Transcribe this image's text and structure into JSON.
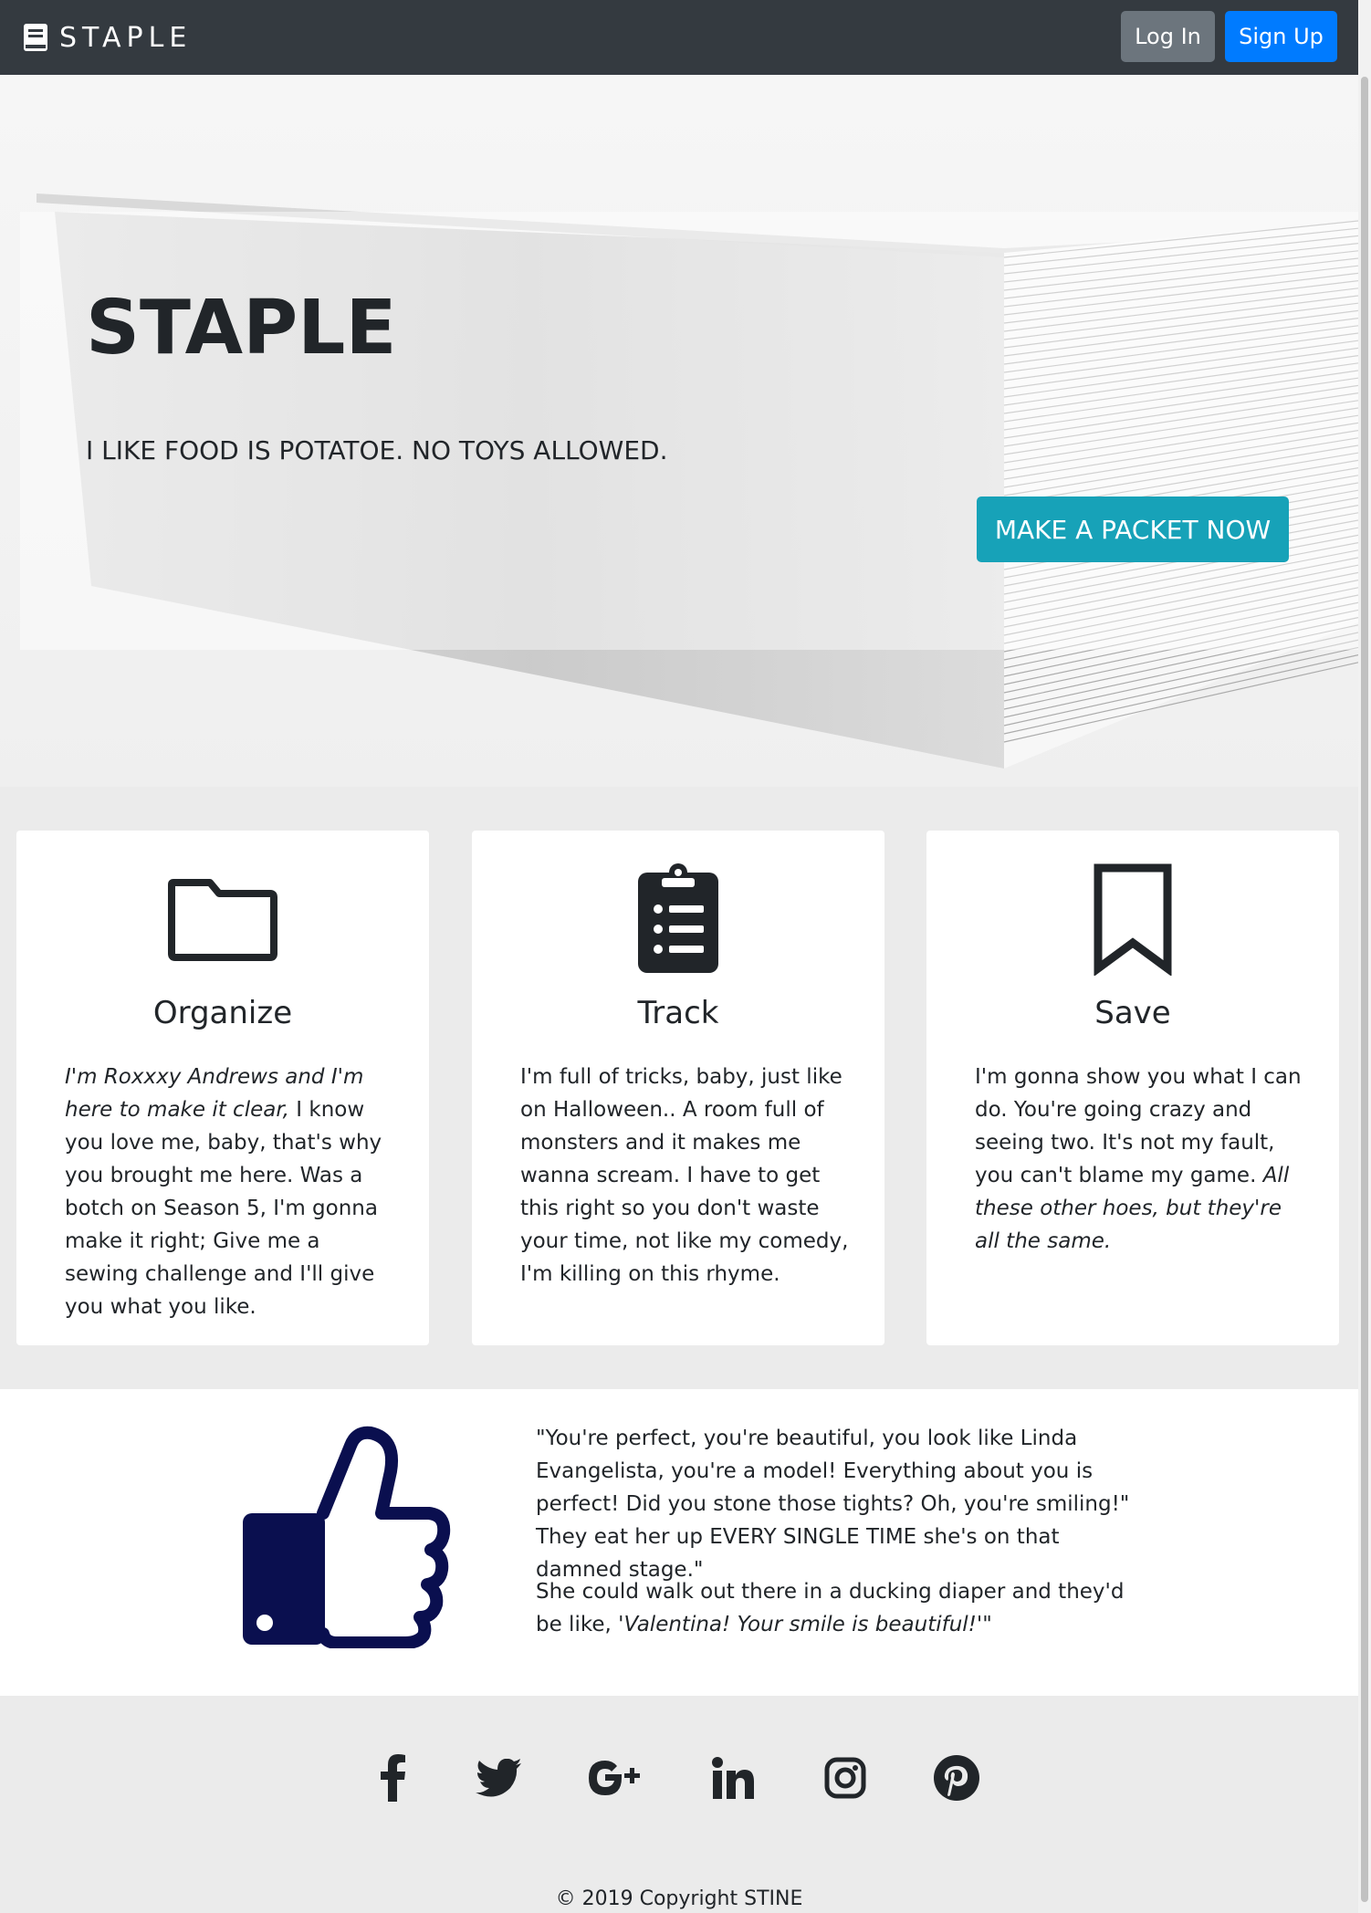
{
  "navbar": {
    "brand": "STAPLE",
    "login_label": "Log In",
    "signup_label": "Sign Up"
  },
  "hero": {
    "title": "STAPLE",
    "subtitle": "I LIKE FOOD IS POTATOE. NO TOYS ALLOWED.",
    "cta_label": "MAKE A PACKET NOW"
  },
  "features": [
    {
      "icon": "folder-icon",
      "title": "Organize",
      "text_italic": "I'm Roxxxy Andrews and I'm here to make it clear,",
      "text": " I know you love me, baby, that's why you brought me here. Was a botch on Season 5, I'm gonna make it right; Give me a sewing challenge and I'll give you what you like."
    },
    {
      "icon": "clipboard-list-icon",
      "title": "Track",
      "text": "I'm full of tricks, baby, just like on Halloween.. A room full of monsters and it makes me wanna scream. I have to get this right so you don't waste your time, not like my comedy, I'm killing on this rhyme."
    },
    {
      "icon": "bookmark-icon",
      "title": "Save",
      "text": "I'm gonna show you what I can do. You're going crazy and seeing two. It's not my fault, you can't blame my game. ",
      "text_italic": "All these other hoes, but they're all the same."
    }
  ],
  "testimonial": {
    "icon": "thumbs-up-icon",
    "quote1": "\"You're perfect, you're beautiful, you look like Linda Evangelista, you're a model! Everything about you is perfect! Did you stone those tights? Oh, you're smiling!\" They eat her up EVERY SINGLE TIME she's on that damned stage.\"",
    "quote2_text": "She could walk out there in a ducking diaper and they'd be like, ",
    "quote2_italic": "'Valentina! Your smile is beautiful!'\""
  },
  "footer": {
    "social": [
      "facebook-icon",
      "twitter-icon",
      "google-plus-icon",
      "linkedin-icon",
      "instagram-icon",
      "pinterest-icon"
    ],
    "copyright": "© 2019 Copyright STINE"
  },
  "colors": {
    "navbar": "#343a40",
    "login": "#6c757d",
    "signup": "#007bff",
    "cta": "#17a2b8",
    "thumb": "#0a0f4f"
  }
}
